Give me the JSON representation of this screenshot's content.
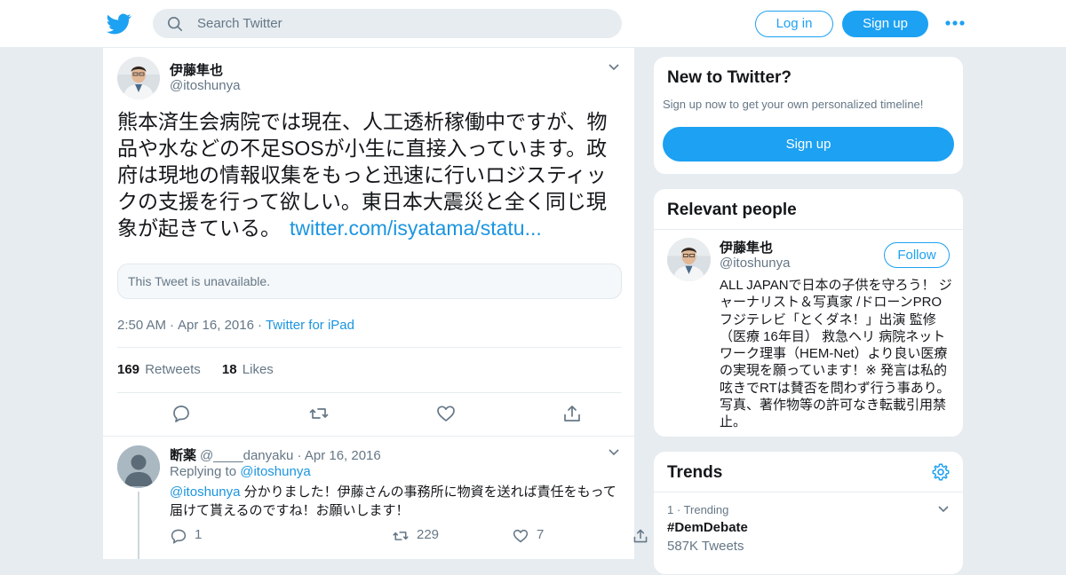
{
  "header": {
    "search_placeholder": "Search Twitter",
    "login_label": "Log in",
    "signup_label": "Sign up"
  },
  "tweet": {
    "author_name": "伊藤隼也",
    "author_handle": "@itoshunya",
    "text": "熊本済生会病院では現在、人工透析稼働中ですが、物品や水などの不足SOSが小生に直接入っています。政府は現地の情報収集をもっと迅速に行いロジスティックの支援を行って欲しい。東日本大震災と全く同じ現象が起きている。",
    "link_text": "twitter.com/isyatama/statu...",
    "quoted_unavailable": "This Tweet is unavailable.",
    "time": "2:50 AM",
    "date": "Apr 16, 2016",
    "source": "Twitter for iPad",
    "retweets_count": "169",
    "retweets_label": "Retweets",
    "likes_count": "18",
    "likes_label": "Likes"
  },
  "reply": {
    "author_name": "断薬",
    "author_handle": "@____danyaku",
    "date": "Apr 16, 2016",
    "replying_prefix": "Replying to",
    "replying_to": "@itoshunya",
    "mention": "@itoshunya",
    "text": "分かりました！伊藤さんの事務所に物資を送れば責任をもって届けて貰えるのですね！お願いします！",
    "reply_count": "1",
    "retweet_count": "229",
    "like_count": "7"
  },
  "new_to_twitter": {
    "title": "New to Twitter?",
    "subtitle": "Sign up now to get your own personalized timeline!",
    "button": "Sign up"
  },
  "relevant_people": {
    "title": "Relevant people",
    "name": "伊藤隼也",
    "handle": "@itoshunya",
    "follow_label": "Follow",
    "bio": "ALL JAPANで日本の子供を守ろう！ ジャーナリスト＆写真家 /ドローンPRO フジテレビ「とくダネ！」出演 監修（医療 16年目） 救急ヘリ 病院ネットワーク理事（HEM-Net）より良い医療の実現を願っています！※ 発言は私的呟きでRTは賛否を問わず行う事あり。写真、著作物等の許可なき転載引用禁止。"
  },
  "trends": {
    "title": "Trends",
    "items": [
      {
        "rank": "1",
        "label": "Trending",
        "name": "#DemDebate",
        "count": "587K Tweets"
      }
    ]
  },
  "colors": {
    "brand": "#1da1f2",
    "link": "#1b95e0",
    "muted": "#657786",
    "background": "#e6ecf0"
  }
}
